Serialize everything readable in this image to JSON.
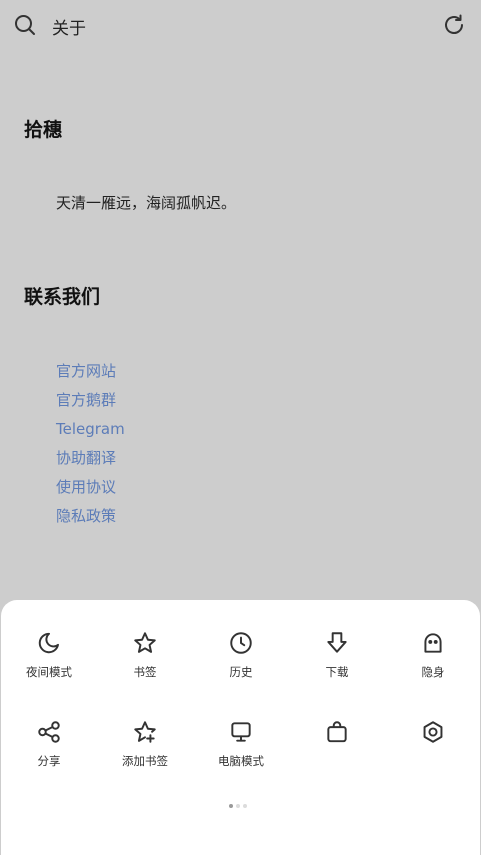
{
  "header": {
    "title": "关于",
    "search_icon": "search-icon",
    "refresh_icon": "refresh-icon"
  },
  "content": {
    "app_name": "拾穗",
    "slogan": "天清一雁远，海阔孤帆迟。",
    "contact_heading": "联系我们",
    "links": [
      "官方网站",
      "官方鹅群",
      "Telegram",
      "协助翻译",
      "使用协议",
      "隐私政策"
    ]
  },
  "menu": {
    "row1": [
      {
        "label": "夜间模式",
        "icon": "moon-icon"
      },
      {
        "label": "书签",
        "icon": "star-icon"
      },
      {
        "label": "历史",
        "icon": "clock-icon"
      },
      {
        "label": "下载",
        "icon": "download-icon"
      },
      {
        "label": "隐身",
        "icon": "ghost-icon"
      }
    ],
    "row2": [
      {
        "label": "分享",
        "icon": "share-icon"
      },
      {
        "label": "添加书签",
        "icon": "add-bookmark-icon"
      },
      {
        "label": "电脑模式",
        "icon": "desktop-icon"
      },
      {
        "label": "",
        "icon": "bag-icon"
      },
      {
        "label": "",
        "icon": "settings-icon"
      }
    ],
    "page_count": 3,
    "current_page": 1
  },
  "colors": {
    "background": "#cdcdcd",
    "link": "#5c7cb8",
    "sheet": "#ffffff"
  }
}
